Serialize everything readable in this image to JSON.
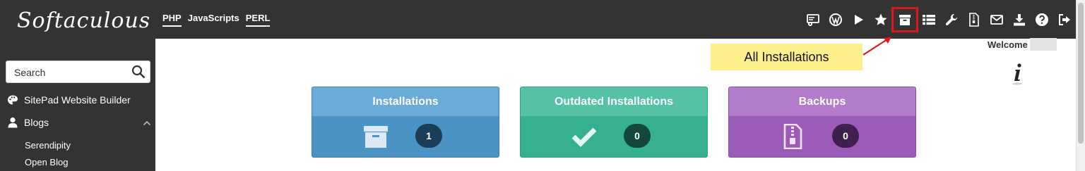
{
  "brand": {
    "logo_text": "Softaculous"
  },
  "toplinks": [
    "PHP",
    "JavaScripts",
    "PERL"
  ],
  "toolbar": {
    "icons": [
      "server-gear-icon",
      "wordpress-icon",
      "play-icon",
      "star-icon",
      "archive-box-icon",
      "list-icon",
      "wrench-icon",
      "zip-file-icon",
      "envelope-icon",
      "download-icon",
      "help-icon",
      "sign-out-icon"
    ],
    "highlighted": "archive-box-icon",
    "highlight_color": "#e0161e"
  },
  "tooltip": {
    "text": "All Installations"
  },
  "welcome": {
    "label": "Welcome"
  },
  "search": {
    "placeholder": "Search"
  },
  "sidebar": {
    "items": [
      {
        "label": "SitePad Website Builder",
        "icon": "palette-icon"
      },
      {
        "label": "Blogs",
        "icon": "user-icon",
        "expanded": true
      }
    ],
    "subitems": [
      "Serendipity",
      "Open Blog"
    ]
  },
  "cards": [
    {
      "title": "Installations",
      "count": "1",
      "icon": "archive-box-icon",
      "color": "#4b93c4"
    },
    {
      "title": "Outdated Installations",
      "count": "0",
      "icon": "checkmark-icon",
      "color": "#35b091"
    },
    {
      "title": "Backups",
      "count": "0",
      "icon": "zip-file-icon",
      "color": "#9b5cb8"
    }
  ]
}
